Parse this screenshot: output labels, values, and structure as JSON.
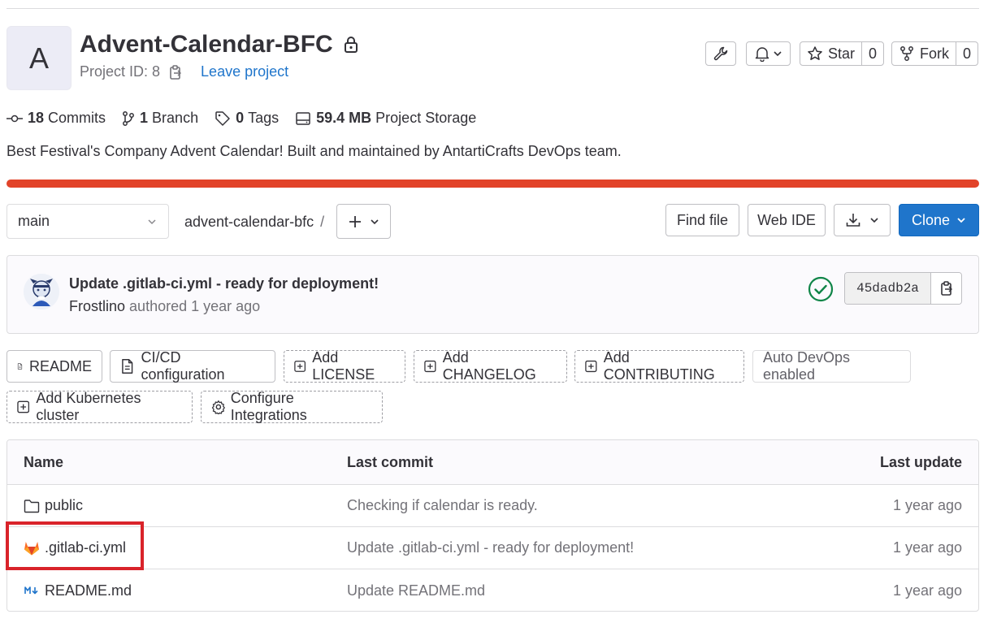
{
  "project": {
    "avatar_letter": "A",
    "name": "Advent-Calendar-BFC",
    "id_label": "Project ID: 8",
    "leave_label": "Leave project",
    "description": "Best Festival's Company Advent Calendar! Built and maintained by AntartiCrafts DevOps team."
  },
  "actions": {
    "star_label": "Star",
    "star_count": "0",
    "fork_label": "Fork",
    "fork_count": "0"
  },
  "stats": {
    "commits_count": "18",
    "commits_label": "Commits",
    "branches_count": "1",
    "branches_label": "Branch",
    "tags_count": "0",
    "tags_label": "Tags",
    "storage_size": "59.4 MB",
    "storage_label": "Project Storage"
  },
  "repo": {
    "branch": "main",
    "path_root": "advent-calendar-bfc",
    "path_sep": "/",
    "find_file_label": "Find file",
    "web_ide_label": "Web IDE",
    "clone_label": "Clone"
  },
  "last_commit": {
    "title": "Update .gitlab-ci.yml - ready for deployment!",
    "author": "Frostlino",
    "authored_text": "authored",
    "time": "1 year ago",
    "sha": "45dadb2a"
  },
  "shortcuts": {
    "readme": "README",
    "cicd": "CI/CD configuration",
    "add_license": "Add LICENSE",
    "add_changelog": "Add CHANGELOG",
    "add_contributing": "Add CONTRIBUTING",
    "auto_devops": "Auto DevOps enabled",
    "add_k8s": "Add Kubernetes cluster",
    "configure_integrations": "Configure Integrations"
  },
  "files": {
    "headers": {
      "name": "Name",
      "last_commit": "Last commit",
      "last_update": "Last update"
    },
    "rows": [
      {
        "name": "public",
        "icon": "folder-icon",
        "commit": "Checking if calendar is ready.",
        "updated": "1 year ago"
      },
      {
        "name": ".gitlab-ci.yml",
        "icon": "gitlab-icon",
        "commit": "Update .gitlab-ci.yml - ready for deployment!",
        "updated": "1 year ago"
      },
      {
        "name": "README.md",
        "icon": "markdown-icon",
        "commit": "Update README.md",
        "updated": "1 year ago"
      }
    ]
  },
  "colors": {
    "accent_blue": "#1f75cb",
    "progress_orange": "#e24329",
    "success_green": "#108548",
    "highlight_red": "#d9232a"
  }
}
